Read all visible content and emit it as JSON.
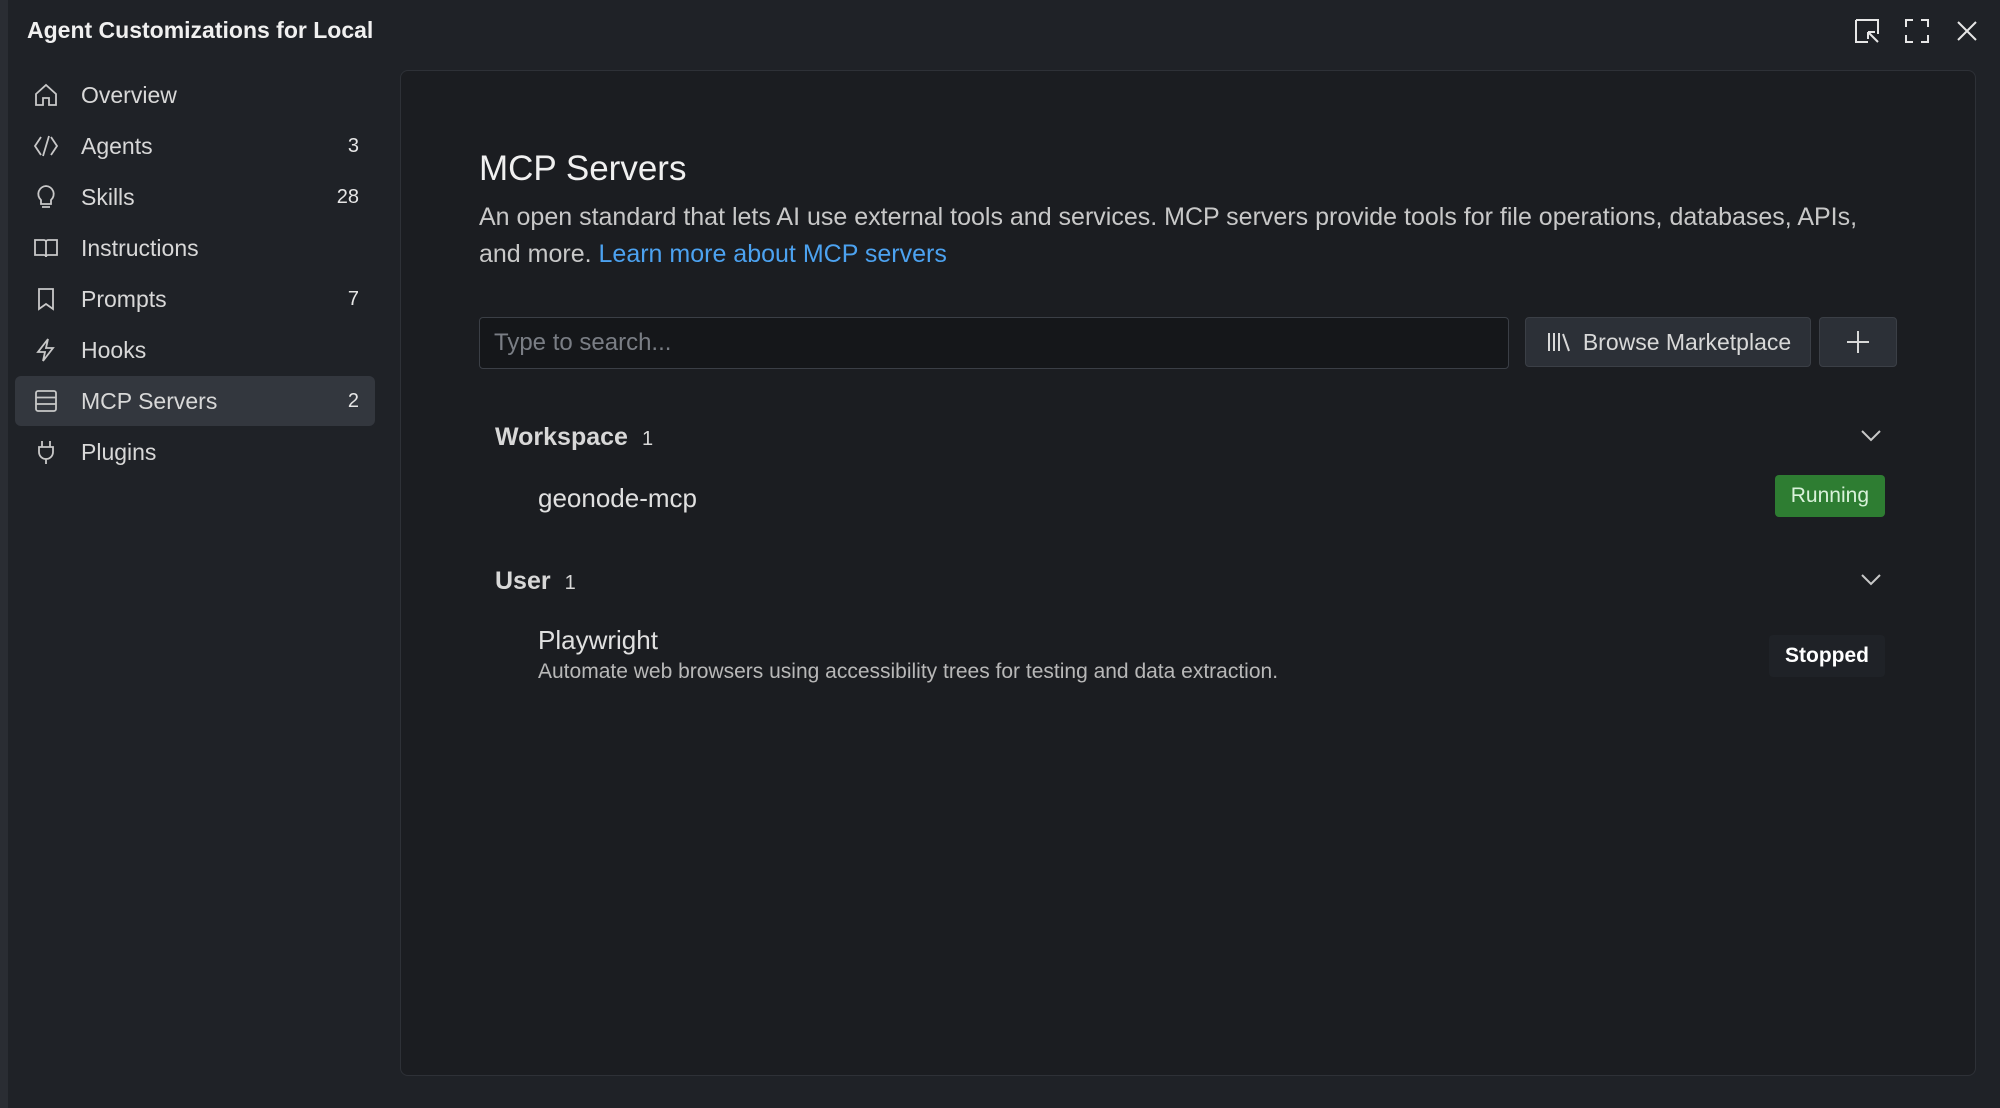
{
  "window": {
    "title": "Agent Customizations for Local"
  },
  "sidebar": {
    "items": [
      {
        "label": "Overview",
        "count": "",
        "icon": "home-icon"
      },
      {
        "label": "Agents",
        "count": "3",
        "icon": "agents-icon"
      },
      {
        "label": "Skills",
        "count": "28",
        "icon": "lightbulb-icon"
      },
      {
        "label": "Instructions",
        "count": "",
        "icon": "book-icon"
      },
      {
        "label": "Prompts",
        "count": "7",
        "icon": "bookmark-icon"
      },
      {
        "label": "Hooks",
        "count": "",
        "icon": "lightning-icon"
      },
      {
        "label": "MCP Servers",
        "count": "2",
        "icon": "server-icon",
        "active": true
      },
      {
        "label": "Plugins",
        "count": "",
        "icon": "plug-icon"
      }
    ]
  },
  "main": {
    "title": "MCP Servers",
    "description": "An open standard that lets AI use external tools and services. MCP servers provide tools for file operations, databases, APIs, and more.",
    "learn_more": "Learn more about MCP servers",
    "search": {
      "placeholder": "Type to search..."
    },
    "browse_button": "Browse Marketplace",
    "groups": [
      {
        "title": "Workspace",
        "count": "1",
        "servers": [
          {
            "name": "geonode-mcp",
            "description": "",
            "status": "Running"
          }
        ]
      },
      {
        "title": "User",
        "count": "1",
        "servers": [
          {
            "name": "Playwright",
            "description": "Automate web browsers using accessibility trees for testing and data extraction.",
            "status": "Stopped"
          }
        ]
      }
    ]
  },
  "colors": {
    "accent_link": "#4ca2f0",
    "running": "#2e7d32",
    "active_item": "#33373e"
  }
}
